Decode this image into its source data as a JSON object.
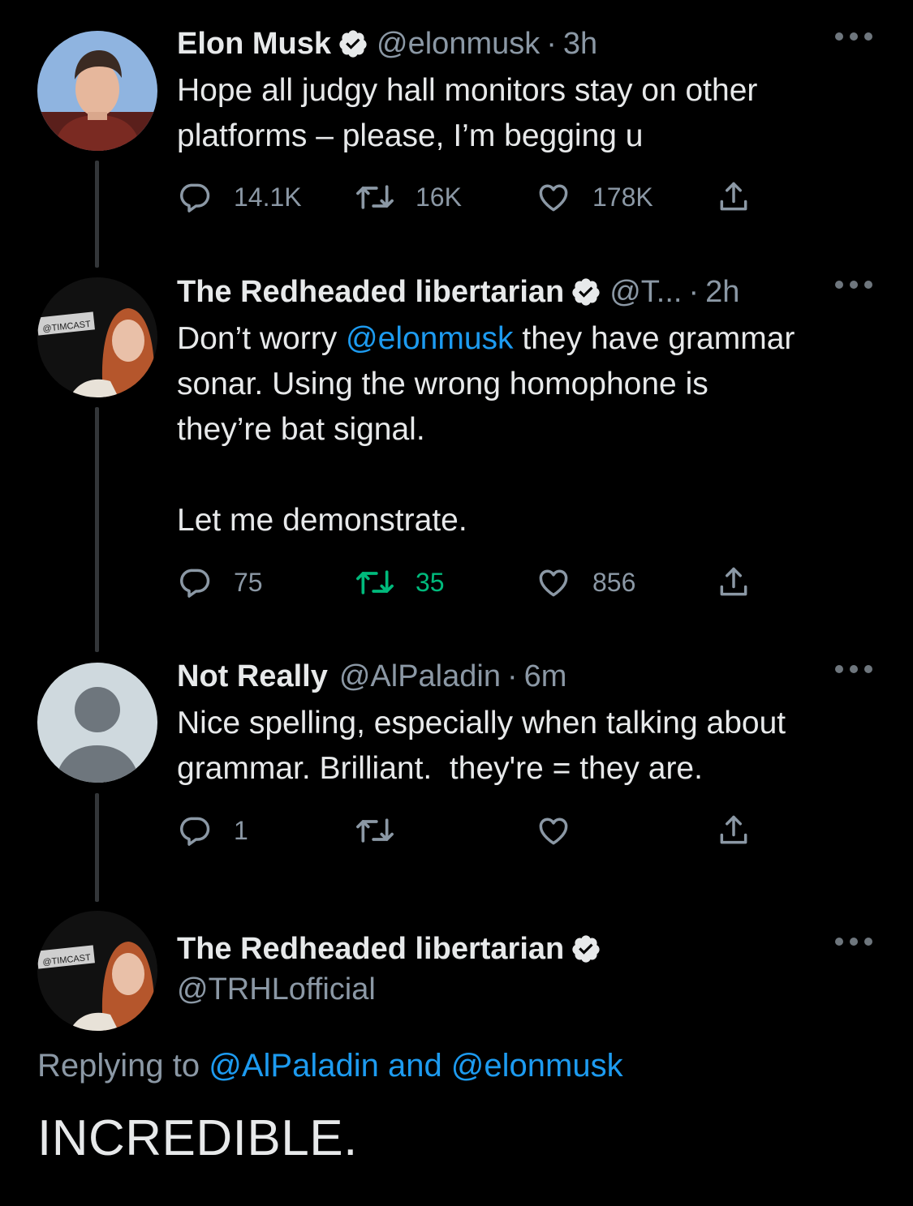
{
  "tweets": [
    {
      "name": "Elon Musk",
      "handle": "@elonmusk",
      "dot": "·",
      "time": "3h",
      "text": "Hope all judgy hall monitors stay on other\nplatforms – please, I’m begging u",
      "replies": "14.1K",
      "retweets": "16K",
      "likes": "178K"
    },
    {
      "name": "The Redheaded libertarian",
      "handle": "@T...",
      "dot": "·",
      "time": "2h",
      "text_before": "Don’t worry ",
      "text_mention": "@elonmusk",
      "text_after": " they have grammar\nsonar. Using the wrong homophone is\nthey’re bat signal.\n\nLet me demonstrate.",
      "replies": "75",
      "retweets": "35",
      "likes": "856",
      "avatar_label": "@TIMCAST"
    },
    {
      "name": "Not Really",
      "handle": "@AlPaladin",
      "dot": "·",
      "time": "6m",
      "text": "Nice spelling, especially when talking about\ngrammar. Brilliant.  they're = they are.",
      "replies": "1"
    }
  ],
  "final": {
    "name": "The Redheaded libertarian",
    "handle": "@TRHLofficial",
    "avatar_label": "@TIMCAST",
    "replying_prefix": "Replying to ",
    "replying_mentions": "@AlPaladin and @elonmusk",
    "text": "INCREDIBLE."
  },
  "icons": {
    "verified": "verified-badge-icon",
    "reply": "reply-icon",
    "retweet": "retweet-icon",
    "like": "heart-icon",
    "share": "share-icon",
    "more": "more-icon"
  },
  "colors": {
    "background": "#000000",
    "link": "#1d9bf0",
    "muted": "#8b98a5",
    "retweet_active": "#00ba7c",
    "verified_badge": "#e7e9ea"
  }
}
